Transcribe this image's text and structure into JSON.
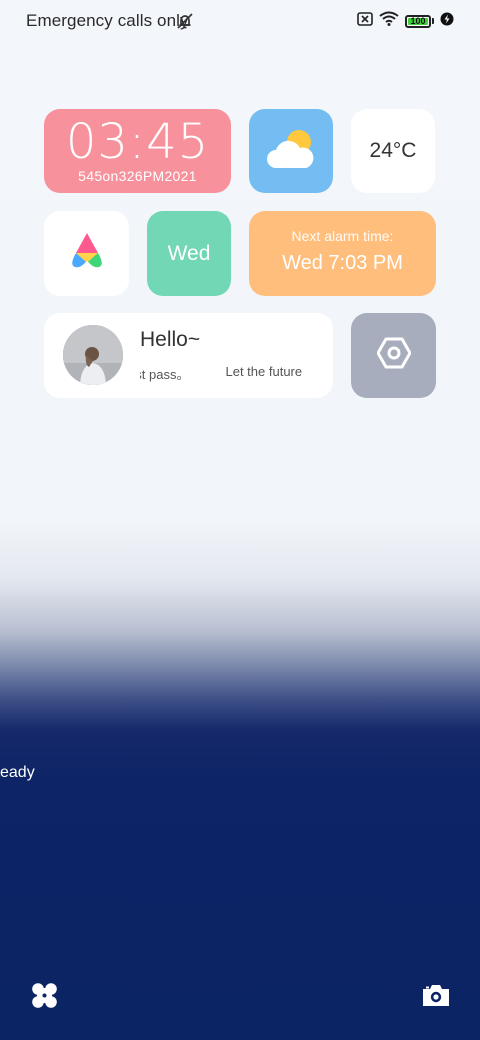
{
  "status_bar": {
    "carrier_text": "Emergency calls only",
    "battery_level": "100",
    "battery_percent": 100,
    "icons": [
      "bell-off-icon",
      "sim-missing-icon",
      "wifi-icon",
      "battery-icon",
      "charging-icon"
    ]
  },
  "widgets": {
    "clock": {
      "time": "03:45",
      "subtitle": "545on326PM2021"
    },
    "weather": {
      "icon": "partly-cloudy-icon"
    },
    "temperature": {
      "value": "24°C"
    },
    "weekday": {
      "label": "Wed"
    },
    "alarm": {
      "label": "Next alarm time:",
      "time": "Wed 7:03 PM"
    },
    "profile": {
      "greeting": "Hello~",
      "marquee": [
        "e past pass。",
        "Let the future"
      ]
    },
    "settings": {
      "icon": "hexagon-settings-icon"
    }
  },
  "lockscreen": {
    "ready_text": "eady"
  },
  "bottom": {
    "left_icon": "flower-icon",
    "right_icon": "camera-icon"
  },
  "colors": {
    "clock_bg": "#f7929c",
    "weather_bg": "#73bdf2",
    "weekday_bg": "#72d7b5",
    "alarm_bg": "#ffbe7b",
    "settings_bg": "#a8adbd",
    "wallpaper_bottom": "#0b2463"
  }
}
